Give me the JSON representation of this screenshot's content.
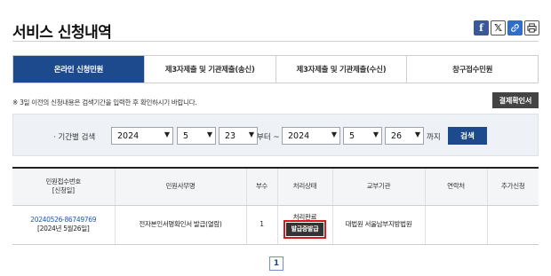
{
  "page": {
    "title": "서비스 신청내역"
  },
  "share": [
    {
      "name": "facebook-icon",
      "glyph": "f"
    },
    {
      "name": "x-icon",
      "glyph": "𝕏"
    },
    {
      "name": "link-icon",
      "glyph": "🔗"
    },
    {
      "name": "print-icon",
      "glyph": "⎙"
    }
  ],
  "tabs": [
    {
      "label": "온라인 신청민원",
      "active": true
    },
    {
      "label": "제3자제출 및 기관제출(송신)",
      "active": false
    },
    {
      "label": "제3자제출 및 기관제출(수신)",
      "active": false
    },
    {
      "label": "창구접수민원",
      "active": false
    }
  ],
  "notice": "※ 3일 이전의 신청내용은 검색기간을 입력한 후 확인하시기 바랍니다.",
  "confirm_button": "결제확인서",
  "search": {
    "label": "· 기간별 검색",
    "from_year": "2024",
    "from_month": "5",
    "from_day": "23",
    "from_suffix": "부터 ~",
    "to_year": "2024",
    "to_month": "5",
    "to_day": "26",
    "to_suffix": "까지",
    "button": "검색"
  },
  "table": {
    "headers": {
      "receipt_line1": "민원접수번호",
      "receipt_line2": "[신청일]",
      "affair": "민원사무명",
      "copies": "부수",
      "status": "처리상태",
      "agency": "교부기관",
      "contact": "연락처",
      "extra": "추가신청"
    },
    "rows": [
      {
        "receipt_no": "20240526-86749769",
        "date": "[2024년 5월26일]",
        "affair": "전자본인서명확인서 발급(열람)",
        "copies": "1",
        "status": "처리완료",
        "issue_button": "발급증발급",
        "agency": "대법원 서울남부지방법원",
        "contact": "",
        "extra": ""
      }
    ]
  },
  "pagination": {
    "current": "1"
  },
  "colors": {
    "primary": "#1c4a8c",
    "highlight": "#e0141b",
    "dark_button": "#333333"
  }
}
